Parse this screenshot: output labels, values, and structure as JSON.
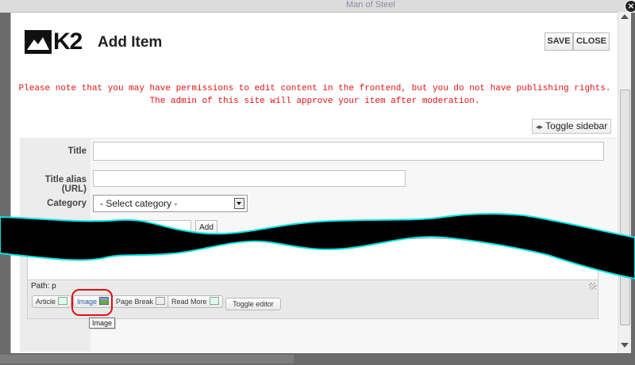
{
  "background_page": {
    "link_text": "Man of Steel"
  },
  "modal": {
    "logo_text": "K2",
    "title": "Add Item",
    "toolbar": {
      "save_label": "SAVE",
      "close_label": "CLOSE"
    },
    "notice": {
      "line1": "Please note that you may have permissions to edit content in the frontend, but you do not have publishing rights.",
      "line2": "The admin of this site will approve your item after moderation.",
      "color": "#e81010"
    },
    "toggle_sidebar_label": "Toggle sidebar",
    "form": {
      "title_label": "Title",
      "title_value": "",
      "alias_label": "Title alias (URL)",
      "alias_value": "",
      "category_label": "Category",
      "category_selected": "- Select category -",
      "add_label": "Add"
    },
    "editor": {
      "path_label": "Path: p",
      "buttons": {
        "article": "Article",
        "image": "Image",
        "page_break": "Page Break",
        "read_more": "Read More"
      },
      "toggle_editor_label": "Toggle editor",
      "tooltip": "Image"
    }
  },
  "colors": {
    "tear_outline": "#00e5e5",
    "tear_fill": "#000000",
    "highlight": "#e01010"
  }
}
